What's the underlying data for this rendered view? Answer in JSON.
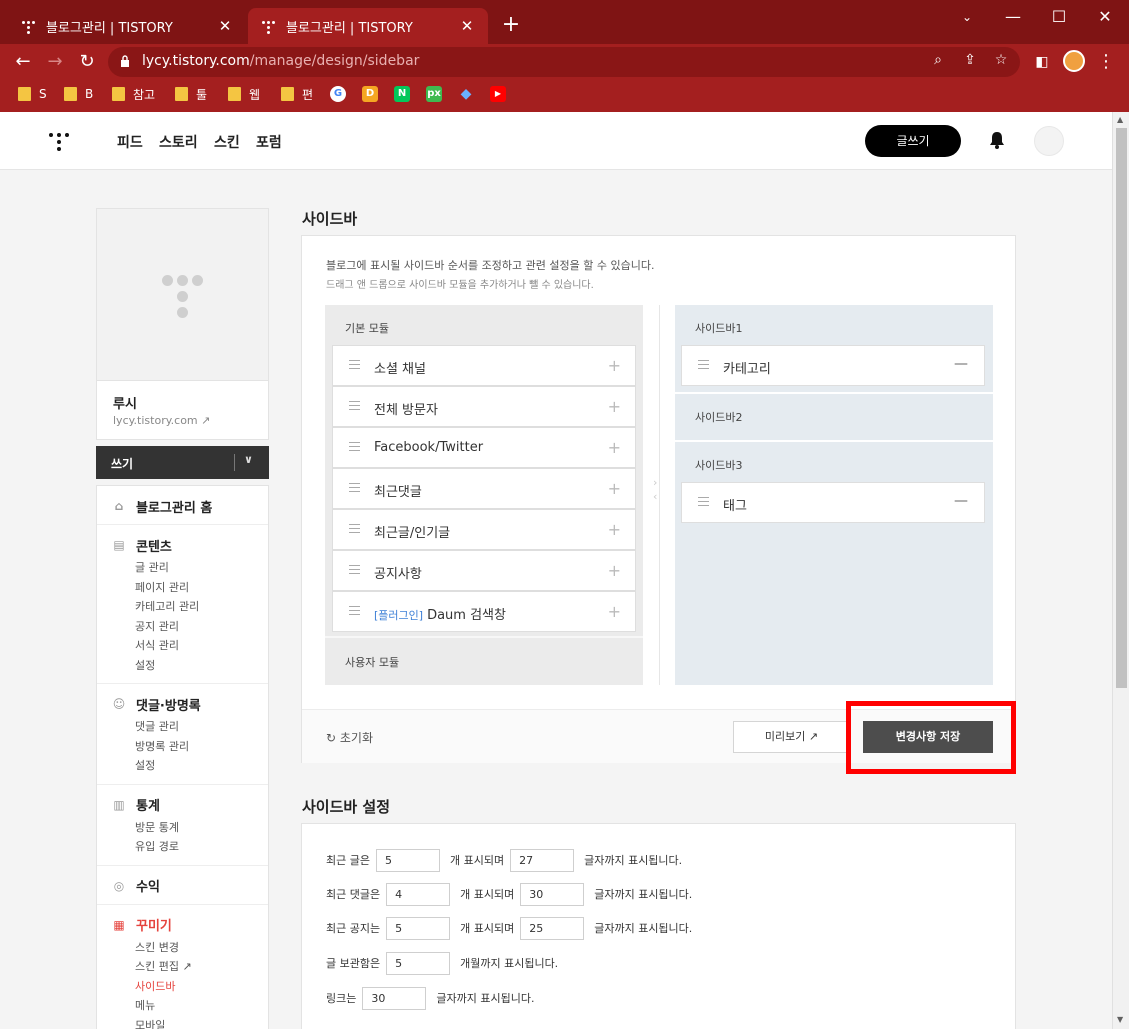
{
  "browser": {
    "tabs": [
      {
        "title": "블로그관리 | TISTORY",
        "active": false
      },
      {
        "title": "블로그관리 | TISTORY",
        "active": true
      }
    ],
    "url_host": "lycy.tistory.com",
    "url_path": "/manage/design/sidebar",
    "bookmarks": [
      "S",
      "B",
      "참고",
      "툴",
      "웹",
      "편"
    ],
    "bookmark_icons": [
      "google-icon",
      "d-icon",
      "n-icon",
      "px-icon",
      "diamond-icon",
      "youtube-icon"
    ],
    "icon_labels": {
      "d": "D",
      "n": "N",
      "px": "px"
    }
  },
  "header": {
    "menu": [
      "피드",
      "스토리",
      "스킨",
      "포럼"
    ],
    "write_button": "글쓰기"
  },
  "sidebar": {
    "blog_name": "루시",
    "blog_url": "lycy.tistory.com",
    "write_label": "쓰기",
    "sections": [
      {
        "title": "블로그관리 홈",
        "icon": "home-icon",
        "items": []
      },
      {
        "title": "콘텐츠",
        "icon": "document-icon",
        "items": [
          "글 관리",
          "페이지 관리",
          "카테고리 관리",
          "공지 관리",
          "서식 관리",
          "설정"
        ]
      },
      {
        "title": "댓글·방명록",
        "icon": "comment-icon",
        "items": [
          "댓글 관리",
          "방명록 관리",
          "설정"
        ]
      },
      {
        "title": "통계",
        "icon": "chart-icon",
        "items": [
          "방문 통계",
          "유입 경로"
        ]
      },
      {
        "title": "수익",
        "icon": "coin-icon",
        "items": []
      },
      {
        "title": "꾸미기",
        "icon": "layout-icon",
        "items": [
          "스킨 변경",
          "스킨 편집",
          "사이드바",
          "메뉴",
          "모바일"
        ],
        "active_item": "사이드바"
      }
    ]
  },
  "main": {
    "title": "사이드바",
    "desc1": "블로그에 표시될 사이드바 순서를 조정하고 관련 설정을 할 수 있습니다.",
    "desc2": "드래그 앤 드롭으로 사이드바 모듈을 추가하거나 뺄 수 있습니다.",
    "basic_modules_label": "기본 모듈",
    "basic_modules": [
      {
        "name": "소셜 채널",
        "prefix": ""
      },
      {
        "name": "전체 방문자",
        "prefix": ""
      },
      {
        "name": "Facebook/Twitter",
        "prefix": ""
      },
      {
        "name": "최근댓글",
        "prefix": ""
      },
      {
        "name": "최근글/인기글",
        "prefix": ""
      },
      {
        "name": "공지사항",
        "prefix": ""
      },
      {
        "name": "Daum 검색창",
        "prefix": "[플러그인]"
      }
    ],
    "user_modules_label": "사용자 모듈",
    "sidebar1_label": "사이드바1",
    "sidebar1_modules": [
      "카테고리"
    ],
    "sidebar2_label": "사이드바2",
    "sidebar3_label": "사이드바3",
    "sidebar3_modules": [
      "태그"
    ],
    "reset_label": "초기화",
    "preview_label": "미리보기",
    "save_label": "변경사항 저장"
  },
  "settings": {
    "title": "사이드바 설정",
    "rows": [
      {
        "label": "최근 글은",
        "v1": "5",
        "mid": "개 표시되며",
        "v2": "27",
        "end": "글자까지 표시됩니다."
      },
      {
        "label": "최근 댓글은",
        "v1": "4",
        "mid": "개 표시되며",
        "v2": "30",
        "end": "글자까지 표시됩니다."
      },
      {
        "label": "최근 공지는",
        "v1": "5",
        "mid": "개 표시되며",
        "v2": "25",
        "end": "글자까지 표시됩니다."
      },
      {
        "label": "글 보관함은",
        "v1": "5",
        "mid": "개월까지 표시됩니다."
      },
      {
        "label": "링크는",
        "v1": "30",
        "mid": "글자까지 표시됩니다."
      }
    ]
  },
  "colors": {
    "chrome": "#a41f1f",
    "accent": "#e5433d",
    "highlight": "#ff0000",
    "save_button": "#4d4d4d"
  }
}
